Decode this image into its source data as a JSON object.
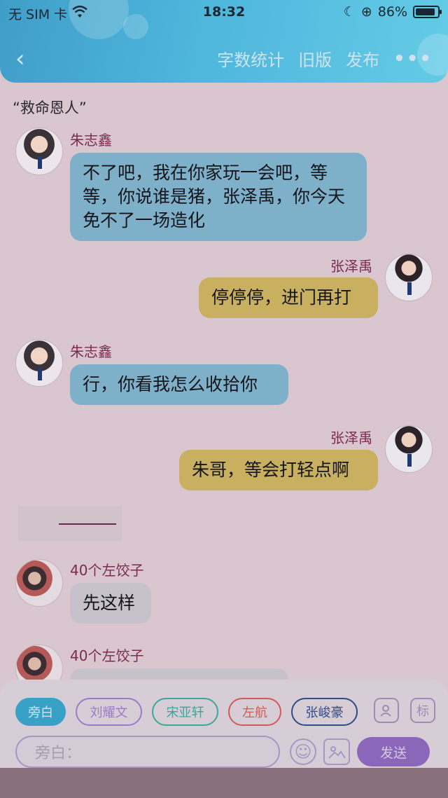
{
  "status": {
    "carrier": "无 SIM 卡",
    "time": "18:32",
    "battery": "86%"
  },
  "nav": {
    "actions": [
      "字数统计",
      "旧版",
      "发布"
    ]
  },
  "chat_title": "“救命恩人”",
  "messages": [
    {
      "side": "left",
      "name": "朱志鑫",
      "text": "不了吧，我在你家玩一会吧，等等，你说谁是猪，张泽禹，你今天免不了一场造化"
    },
    {
      "side": "right",
      "name": "张泽禹",
      "text": "停停停，进门再打"
    },
    {
      "side": "left",
      "name": "朱志鑫",
      "text": "行，你看我怎么收拾你"
    },
    {
      "side": "right",
      "name": "张泽禹",
      "text": "朱哥，等会打轻点啊"
    },
    {
      "side": "left",
      "name": "40个左饺子",
      "text": "先这样"
    },
    {
      "side": "left",
      "name": "40个左饺子",
      "text": ""
    }
  ],
  "roles": [
    {
      "label": "旁白",
      "color": "#39a0c6",
      "active": true
    },
    {
      "label": "刘耀文",
      "color": "#9a7bc7",
      "active": false
    },
    {
      "label": "宋亚轩",
      "color": "#3aa79a",
      "active": false
    },
    {
      "label": "左航",
      "color": "#d05a55",
      "active": false
    },
    {
      "label": "张峻豪",
      "color": "#2f4d86",
      "active": false
    }
  ],
  "toolbar": {
    "mark_label": "标",
    "input_placeholder": "旁白：",
    "send_label": "发送"
  }
}
